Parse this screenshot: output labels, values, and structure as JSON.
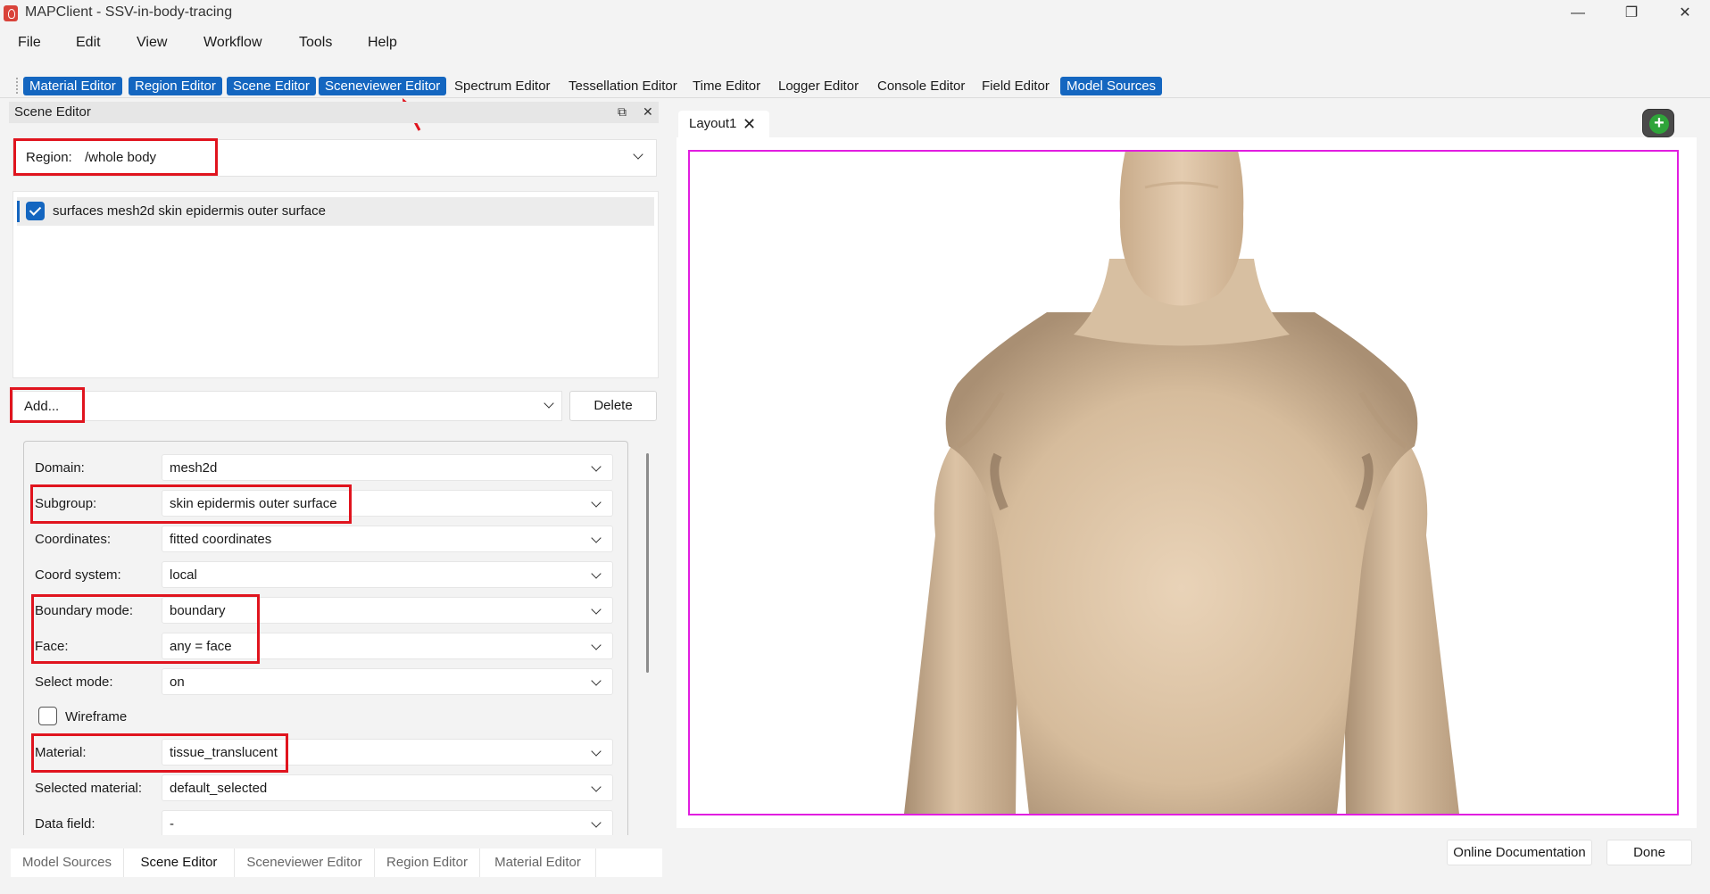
{
  "window": {
    "title": "MAPClient - SSV-in-body-tracing",
    "minimize_glyph": "—",
    "restore_glyph": "❐",
    "close_glyph": "✕"
  },
  "menu": [
    "File",
    "Edit",
    "View",
    "Workflow",
    "Tools",
    "Help"
  ],
  "toolbar": {
    "buttons": [
      {
        "label": "Material Editor",
        "active": true
      },
      {
        "label": "Region Editor",
        "active": true
      },
      {
        "label": "Scene Editor",
        "active": true
      },
      {
        "label": "Sceneviewer Editor",
        "active": true
      },
      {
        "label": "Spectrum Editor",
        "active": false
      },
      {
        "label": "Tessellation Editor",
        "active": false
      },
      {
        "label": "Time Editor",
        "active": false
      },
      {
        "label": "Logger Editor",
        "active": false
      },
      {
        "label": "Console Editor",
        "active": false
      },
      {
        "label": "Field Editor",
        "active": false
      },
      {
        "label": "Model Sources",
        "active": true
      }
    ]
  },
  "scene_editor": {
    "title": "Scene Editor",
    "region_label": "Region:",
    "region_value": "/whole body",
    "graphics_list": [
      {
        "label": "surfaces mesh2d skin epidermis outer surface",
        "checked": true
      }
    ],
    "add_label": "Add...",
    "delete_label": "Delete",
    "fields": {
      "domain": {
        "label": "Domain:",
        "value": "mesh2d"
      },
      "subgroup": {
        "label": "Subgroup:",
        "value": "skin epidermis outer surface"
      },
      "coordinates": {
        "label": "Coordinates:",
        "value": "fitted coordinates"
      },
      "coord_system": {
        "label": "Coord system:",
        "value": "local"
      },
      "boundary_mode": {
        "label": "Boundary mode:",
        "value": "boundary"
      },
      "face": {
        "label": "Face:",
        "value": "any = face"
      },
      "select_mode": {
        "label": "Select mode:",
        "value": "on"
      },
      "wireframe": {
        "label": "Wireframe",
        "checked": false
      },
      "material": {
        "label": "Material:",
        "value": "tissue_translucent"
      },
      "selected_material": {
        "label": "Selected material:",
        "value": "default_selected"
      },
      "data_field": {
        "label": "Data field:",
        "value": "-"
      }
    }
  },
  "bottom_tabs": [
    {
      "label": "Model Sources",
      "active": false
    },
    {
      "label": "Scene Editor",
      "active": true
    },
    {
      "label": "Sceneviewer Editor",
      "active": false
    },
    {
      "label": "Region Editor",
      "active": false
    },
    {
      "label": "Material Editor",
      "active": false
    }
  ],
  "viewer": {
    "tab_label": "Layout1",
    "add_layout_icon": "plus-circle-icon",
    "frame_color": "#e11ee0",
    "skin_color": "#d8c0a3"
  },
  "footer": {
    "online_docs_label": "Online Documentation",
    "done_label": "Done"
  },
  "colors": {
    "accent": "#1466c0",
    "highlight": "#e0141e"
  }
}
